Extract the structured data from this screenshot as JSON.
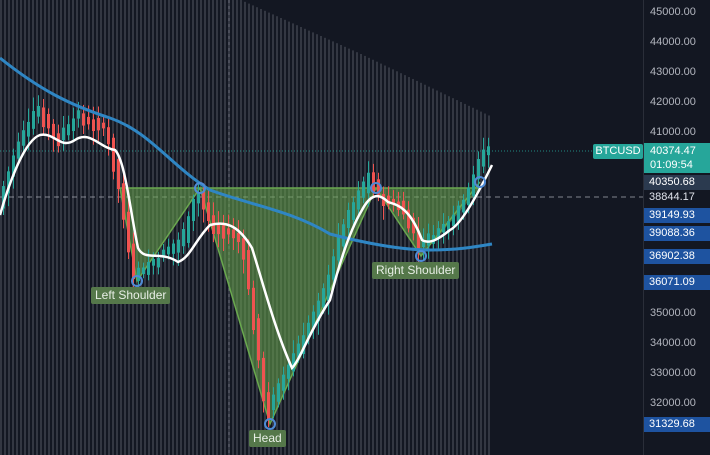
{
  "symbol": "BTCUSD",
  "last_price": "40374.47",
  "countdown": "01:09:54",
  "colors": {
    "background": "#131722",
    "up": "#26a69a",
    "down": "#ef5350",
    "volume": "#8a8d96",
    "pattern_fill": "#6aa84f",
    "pattern_label_bg": "#55784a",
    "ma_white": "#ffffff",
    "ma_blue": "#2f86c4",
    "marker": "#4f8bd6",
    "price_label_dark": "#1e53a0"
  },
  "axis_ticks": [
    "45000.00",
    "44000.00",
    "43000.00",
    "42000.00",
    "41000.00",
    "35000.00",
    "34000.00",
    "33000.00",
    "32000.00"
  ],
  "price_labels": [
    {
      "value": "40350.68",
      "style": "dark"
    },
    {
      "value": "38844.17",
      "style": "plain"
    },
    {
      "value": "39149.93",
      "style": "dark"
    },
    {
      "value": "39088.36",
      "style": "dark"
    },
    {
      "value": "36902.38",
      "style": "dark"
    },
    {
      "value": "36071.09",
      "style": "dark"
    },
    {
      "value": "31329.68",
      "style": "dark"
    }
  ],
  "pattern_labels": {
    "left_shoulder": "Left Shoulder",
    "head": "Head",
    "right_shoulder": "Right Shoulder"
  }
}
